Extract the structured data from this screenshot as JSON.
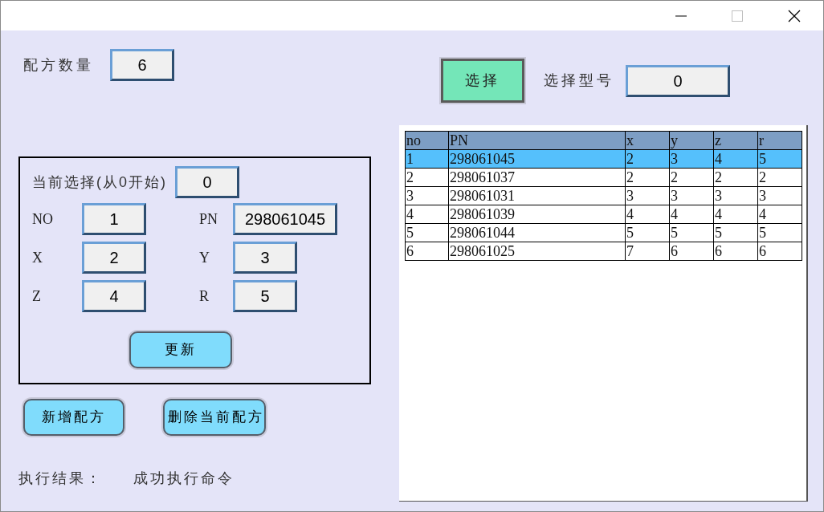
{
  "recipe_count": {
    "label": "配方数量",
    "value": "6"
  },
  "select_button": {
    "label": "选择"
  },
  "model_select": {
    "label": "选择型号",
    "value": "0"
  },
  "current_group": {
    "selection": {
      "label": "当前选择(从0开始)",
      "value": "0"
    },
    "fields": [
      {
        "label": "NO",
        "value": "1"
      },
      {
        "label": "PN",
        "value": "298061045"
      },
      {
        "label": "X",
        "value": "2"
      },
      {
        "label": "Y",
        "value": "3"
      },
      {
        "label": "Z",
        "value": "4"
      },
      {
        "label": "R",
        "value": "5"
      }
    ],
    "update_button": "更新"
  },
  "buttons": [
    "新增配方",
    "删除当前配方"
  ],
  "result": {
    "label": "执行结果：",
    "value": "成功执行命令"
  },
  "table": {
    "columns": [
      "no",
      "PN",
      "x",
      "y",
      "z",
      "r"
    ],
    "rows": [
      {
        "cells": [
          "1",
          "298061045",
          "2",
          "3",
          "4",
          "5"
        ],
        "selected": true
      },
      {
        "cells": [
          "2",
          "298061037",
          "2",
          "2",
          "2",
          "2"
        ],
        "selected": false
      },
      {
        "cells": [
          "3",
          "298061031",
          "3",
          "3",
          "3",
          "3"
        ],
        "selected": false
      },
      {
        "cells": [
          "4",
          "298061039",
          "4",
          "4",
          "4",
          "4"
        ],
        "selected": false
      },
      {
        "cells": [
          "5",
          "298061044",
          "5",
          "5",
          "5",
          "5"
        ],
        "selected": false
      },
      {
        "cells": [
          "6",
          "298061025",
          "7",
          "6",
          "6",
          "6"
        ],
        "selected": false
      }
    ]
  }
}
